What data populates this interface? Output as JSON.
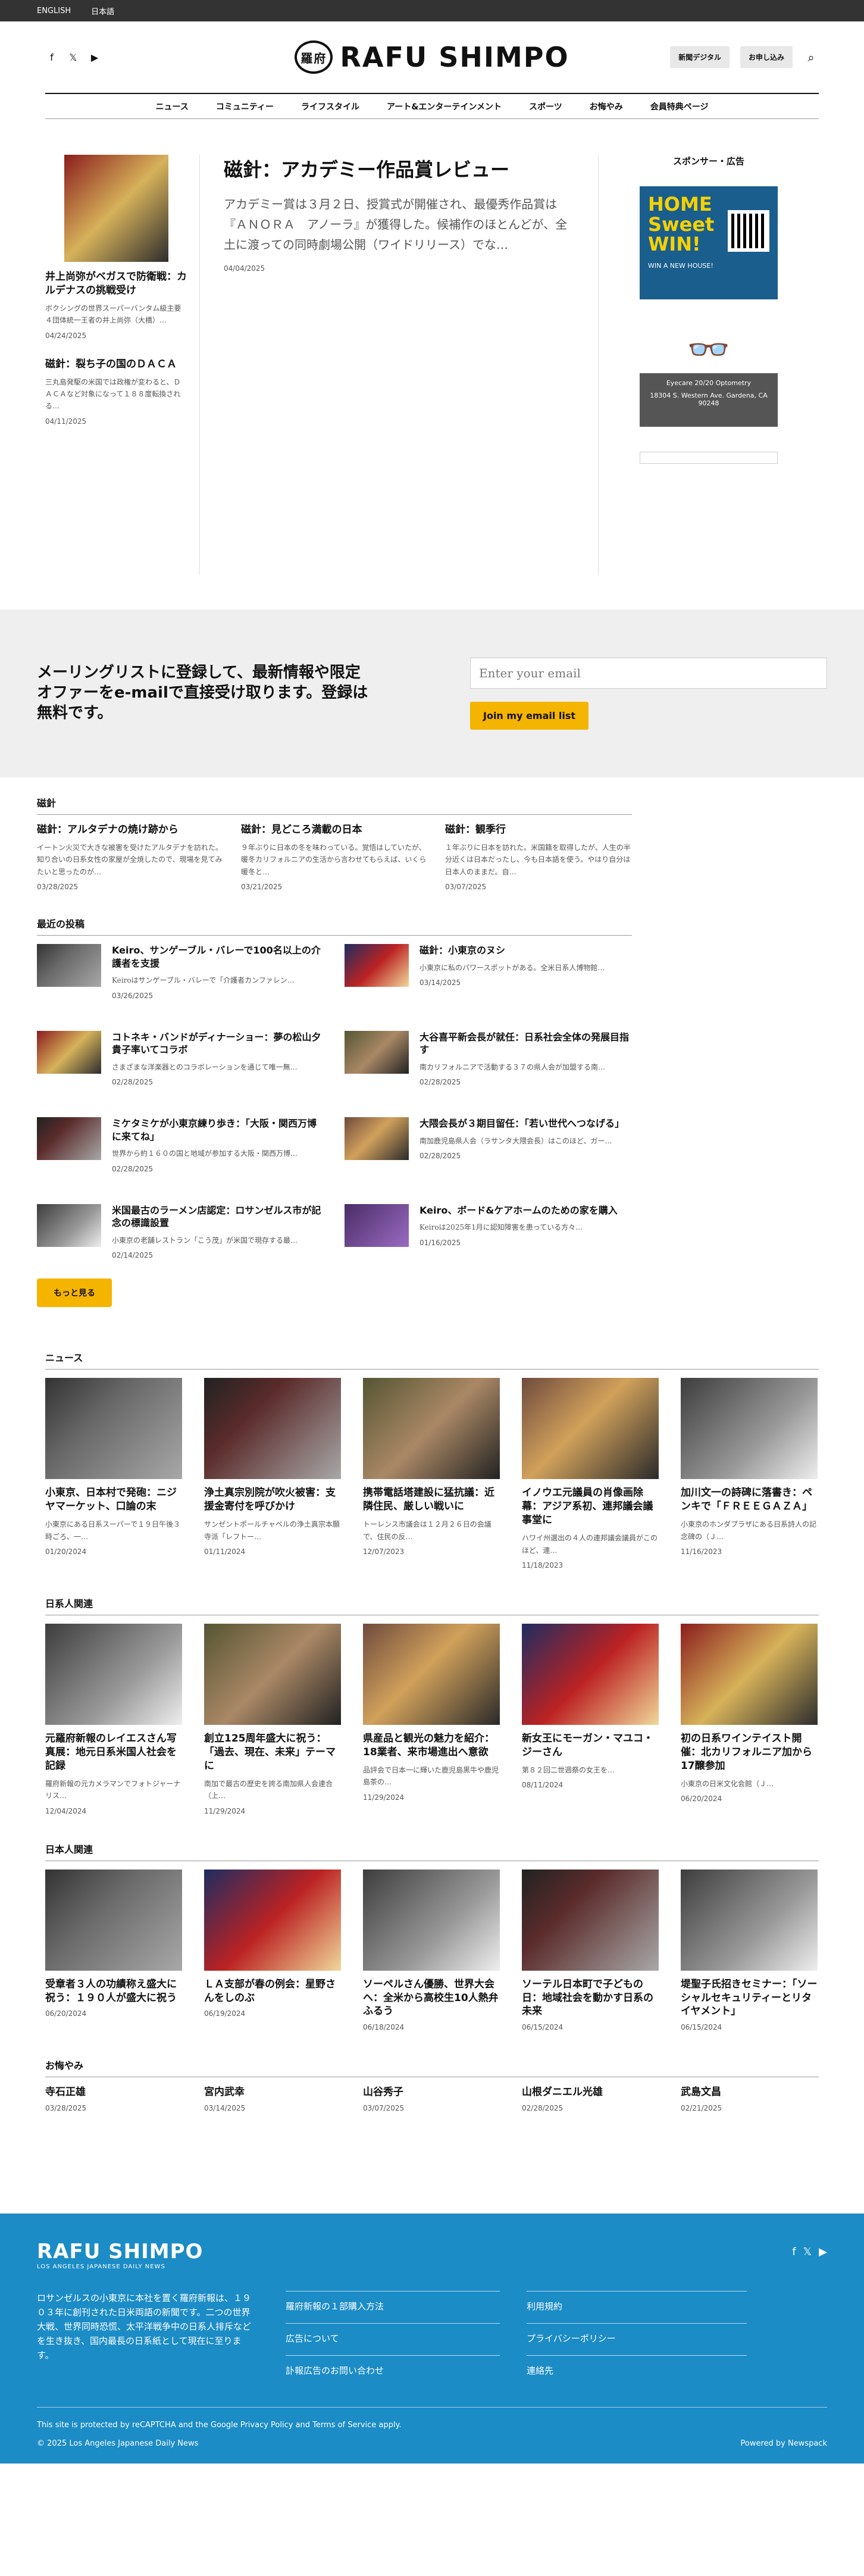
{
  "topbar": {
    "lang_en": "ENGLISH",
    "lang_ja": "日本語"
  },
  "header": {
    "logo_mark": "羅府",
    "logo_text": "RAFU SHIMPO",
    "digital_button": "新聞デジタル",
    "subscribe_button": "お申し込み"
  },
  "nav": [
    "ニュース",
    "コミュニティー",
    "ライフスタイル",
    "アート&エンターテインメント",
    "スポーツ",
    "お悔やみ",
    "会員特典ページ"
  ],
  "hero": {
    "left": [
      {
        "title": "井上尚弥がベガスで防衛戦：カルデナスの挑戦受け",
        "excerpt": "ボクシングの世界スーパーバンタム級主要４団体統一王者の井上尚弥（大橋）…",
        "date": "04/24/2025"
      },
      {
        "title": "磁針：裂ち子の国のＤＡＣＡ",
        "excerpt": "三丸島発駆の米国では政権が変わると、ＤＡＣＡなど対象になって１８８度転換される…",
        "date": "04/11/2025"
      }
    ],
    "main": {
      "title": "磁針：アカデミー作品賞レビュー",
      "excerpt": "アカデミー賞は３月２日、授賞式が開催され、最優秀作品賞は『ＡＮＯＲＡ　アノーラ』が獲得した。候補作のほとんどが、全土に渡っての同時劇場公開（ワイドリリース）でな…",
      "date": "04/04/2025"
    }
  },
  "sidebar": {
    "title": "スポンサー・広告",
    "ad1_headline": "HOME Sweet WIN!",
    "ad1_small": "WIN A NEW HOUSE!",
    "ad2_title": "Eyecare 20/20 Optometry",
    "ad2_address": "18304 S. Western Ave. Gardena, CA 90248"
  },
  "newsletter": {
    "title": "メーリングリストに登録して、最新情報や限定オファーをe-mailで直接受け取ります。登録は無料です。",
    "placeholder": "Enter your email",
    "button": "Join my email list"
  },
  "magnetic": {
    "heading": "磁針",
    "items": [
      {
        "title": "磁針：アルタデナの焼け跡から",
        "excerpt": "イートン火災で大きな被害を受けたアルタデナを訪れた。知り合いの日系女性の家屋が全焼したので、現場を見てみたいと思ったのが…",
        "date": "03/28/2025"
      },
      {
        "title": "磁針：見どころ満載の日本",
        "excerpt": "９年ぶりに日本の冬を味わっている。覚悟はしていたが、暖冬カリフォルニアの生活から言わせてもらえば、いくら暖冬と…",
        "date": "03/21/2025"
      },
      {
        "title": "磁針：観季行",
        "excerpt": "１年ぶりに日本を訪れた。米国籍を取得したが、人生の半分近くは日本だったし、今も日本語を使う。やはり自分は日本人のままだ。自…",
        "date": "03/07/2025"
      }
    ]
  },
  "recent": {
    "heading": "最近の投稿",
    "items": [
      {
        "title": "Keiro、サンゲーブル・バレーで100名以上の介護者を支援",
        "excerpt": "Keiroはサンゲーブル・バレーで「介護者カンファレン…",
        "date": "03/26/2025"
      },
      {
        "title": "磁針：小東京のヌシ",
        "excerpt": "小東京に私のパワースポットがある。全米日系人博物館…",
        "date": "03/14/2025"
      },
      {
        "title": "コトネキ・バンドがディナーショー：夢の松山夕貴子率いてコラボ",
        "excerpt": "さまざまな洋楽器とのコラボレーションを通じて唯一無…",
        "date": "02/28/2025"
      },
      {
        "title": "大谷喜平新会長が就任：日系社会全体の発展目指す",
        "excerpt": "南カリフォルニアで活動する３７の県人会が加盟する南…",
        "date": "02/28/2025"
      },
      {
        "title": "ミケタミケが小東京練り歩き：「大阪・関西万博に来てね」",
        "excerpt": "世界から約１６０の国と地域が参加する大阪・関西万博…",
        "date": "02/28/2025"
      },
      {
        "title": "大隈会長が３期目留任：「若い世代へつなげる」",
        "excerpt": "南加鹿児島県人会（ラサンタ大隈会長）はこのほど、ガー…",
        "date": "02/28/2025"
      },
      {
        "title": "米国最古のラーメン店認定：ロサンゼルス市が記念の標識設置",
        "excerpt": "小東京の老舗レストラン「こう茂」が米国で現存する最…",
        "date": "02/14/2025"
      },
      {
        "title": "Keiro、ボード&ケアホームのための家を購入",
        "excerpt": "Keiroは2025年1月に認知障害を患っている方々…",
        "date": "01/16/2025"
      }
    ],
    "more": "もっと見る"
  },
  "news": {
    "heading": "ニュース",
    "items": [
      {
        "title": "小東京、日本村で発砲：ニジヤマーケット、口論の末",
        "excerpt": "小東京にある日系スーパーで１９日午後３時ごろ、一…",
        "date": "01/20/2024"
      },
      {
        "title": "浄土真宗別院が吹火被害：支援金寄付を呼びかけ",
        "excerpt": "サンゼントポールチャペルの浄土真宗本願寺派「レフトー…",
        "date": "01/11/2024"
      },
      {
        "title": "携帯電話塔建設に猛抗議：近隣住民、厳しい戦いに",
        "excerpt": "トーレンス市議会は１２月２６日の会議で、住民の反…",
        "date": "12/07/2023"
      },
      {
        "title": "イノウエ元議員の肖像画除幕：アジア系初、連邦議会議事堂に",
        "excerpt": "ハワイ州選出の４人の連邦議会議員がこのほど、連…",
        "date": "11/18/2023"
      },
      {
        "title": "加川文一の詩碑に落書き：ペンキで「ＦＲＥＥＧＡＺＡ」",
        "excerpt": "小東京のホンダプラザにある日系詩人の記念碑の（Ｊ…",
        "date": "11/16/2023"
      }
    ]
  },
  "nikkei": {
    "heading": "日系人関連",
    "items": [
      {
        "title": "元羅府新報のレイエスさん写真展：地元日系米国人社会を記録",
        "excerpt": "羅府新報の元カメラマンでフォトジャーナリス…",
        "date": "12/04/2024"
      },
      {
        "title": "創立125周年盛大に祝う：「過去、現在、未来」テーマに",
        "excerpt": "南加で最古の歴史を誇る南加県人会連合（上…",
        "date": "11/29/2024"
      },
      {
        "title": "県産品と観光の魅力を紹介：18業者、来市場進出へ意欲",
        "excerpt": "品評会で日本一に輝いた鹿児島黒牛や鹿児島茶の…",
        "date": "11/29/2024"
      },
      {
        "title": "新女王にモーガン・マユコ・ジーさん",
        "excerpt": "第８２回二世週祭の女王を…",
        "date": "08/11/2024"
      },
      {
        "title": "初の日系ワインテイスト開催：北カリフォルニア加から17醸参加",
        "excerpt": "小東京の日米文化会館（Ｊ…",
        "date": "06/20/2024"
      }
    ]
  },
  "japanese": {
    "heading": "日本人関連",
    "items": [
      {
        "title": "受章者３人の功績称え盛大に祝う：１９０人が盛大に祝う",
        "date": "06/20/2024"
      },
      {
        "title": "ＬＡ支部が春の例会：星野さんをしのぶ",
        "date": "06/19/2024"
      },
      {
        "title": "ソーペルさん優勝、世界大会へ：全米から高校生10人熱弁ふるう",
        "date": "06/18/2024"
      },
      {
        "title": "ソーテル日本町で子どもの日：地域社会を動かす日系の未来",
        "date": "06/15/2024"
      },
      {
        "title": "堤聖子氏招きセミナー：「ソーシャルセキュリティーとリタイヤメント」",
        "date": "06/15/2024"
      }
    ]
  },
  "obituaries": {
    "heading": "お悔やみ",
    "items": [
      {
        "title": "寺石正雄",
        "date": "03/28/2025"
      },
      {
        "title": "宮内武幸",
        "date": "03/14/2025"
      },
      {
        "title": "山谷秀子",
        "date": "03/07/2025"
      },
      {
        "title": "山根ダニエル光雄",
        "date": "02/28/2025"
      },
      {
        "title": "武島文昌",
        "date": "02/21/2025"
      }
    ]
  },
  "footer": {
    "logo": "RAFU SHIMPO",
    "tagline": "LOS ANGELES JAPANESE DAILY NEWS",
    "description": "ロサンゼルスの小東京に本社を置く羅府新報は、１９０３年に創刊された日米両語の新聞です。二つの世界大戦、世界同時恐慌、太平洋戦争中の日系人排斥などを生き抜き、国内最長の日系紙として現在に至ります。",
    "links_left": [
      "羅府新報の１部購入方法",
      "広告について",
      "訃報広告のお問い合わせ"
    ],
    "links_right": [
      "利用規約",
      "プライバシーポリシー",
      "連絡先"
    ],
    "recaptcha": "This site is protected by reCAPTCHA and the Google Privacy Policy and Terms of Service apply.",
    "copyright": "© 2025 Los Angeles Japanese Daily News",
    "powered": "Powered by Newspack"
  }
}
